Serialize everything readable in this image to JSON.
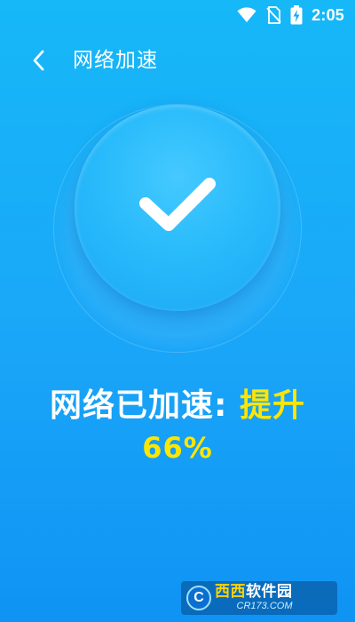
{
  "status_bar": {
    "time": "2:05",
    "icons": [
      "wifi-icon",
      "no-sim-icon",
      "battery-charging-icon"
    ]
  },
  "header": {
    "back_icon": "chevron-left-icon",
    "title": "网络加速"
  },
  "result": {
    "icon": "checkmark-icon",
    "label": "网络已加速: ",
    "highlight": "提升",
    "percent": "66%"
  },
  "watermark": {
    "brand_accent": "西西",
    "brand_rest": "软件园",
    "domain": "CR173.COM"
  },
  "colors": {
    "background_top": "#16b8f8",
    "background_bottom": "#0f93f4",
    "highlight": "#ffe600",
    "text": "#ffffff"
  }
}
